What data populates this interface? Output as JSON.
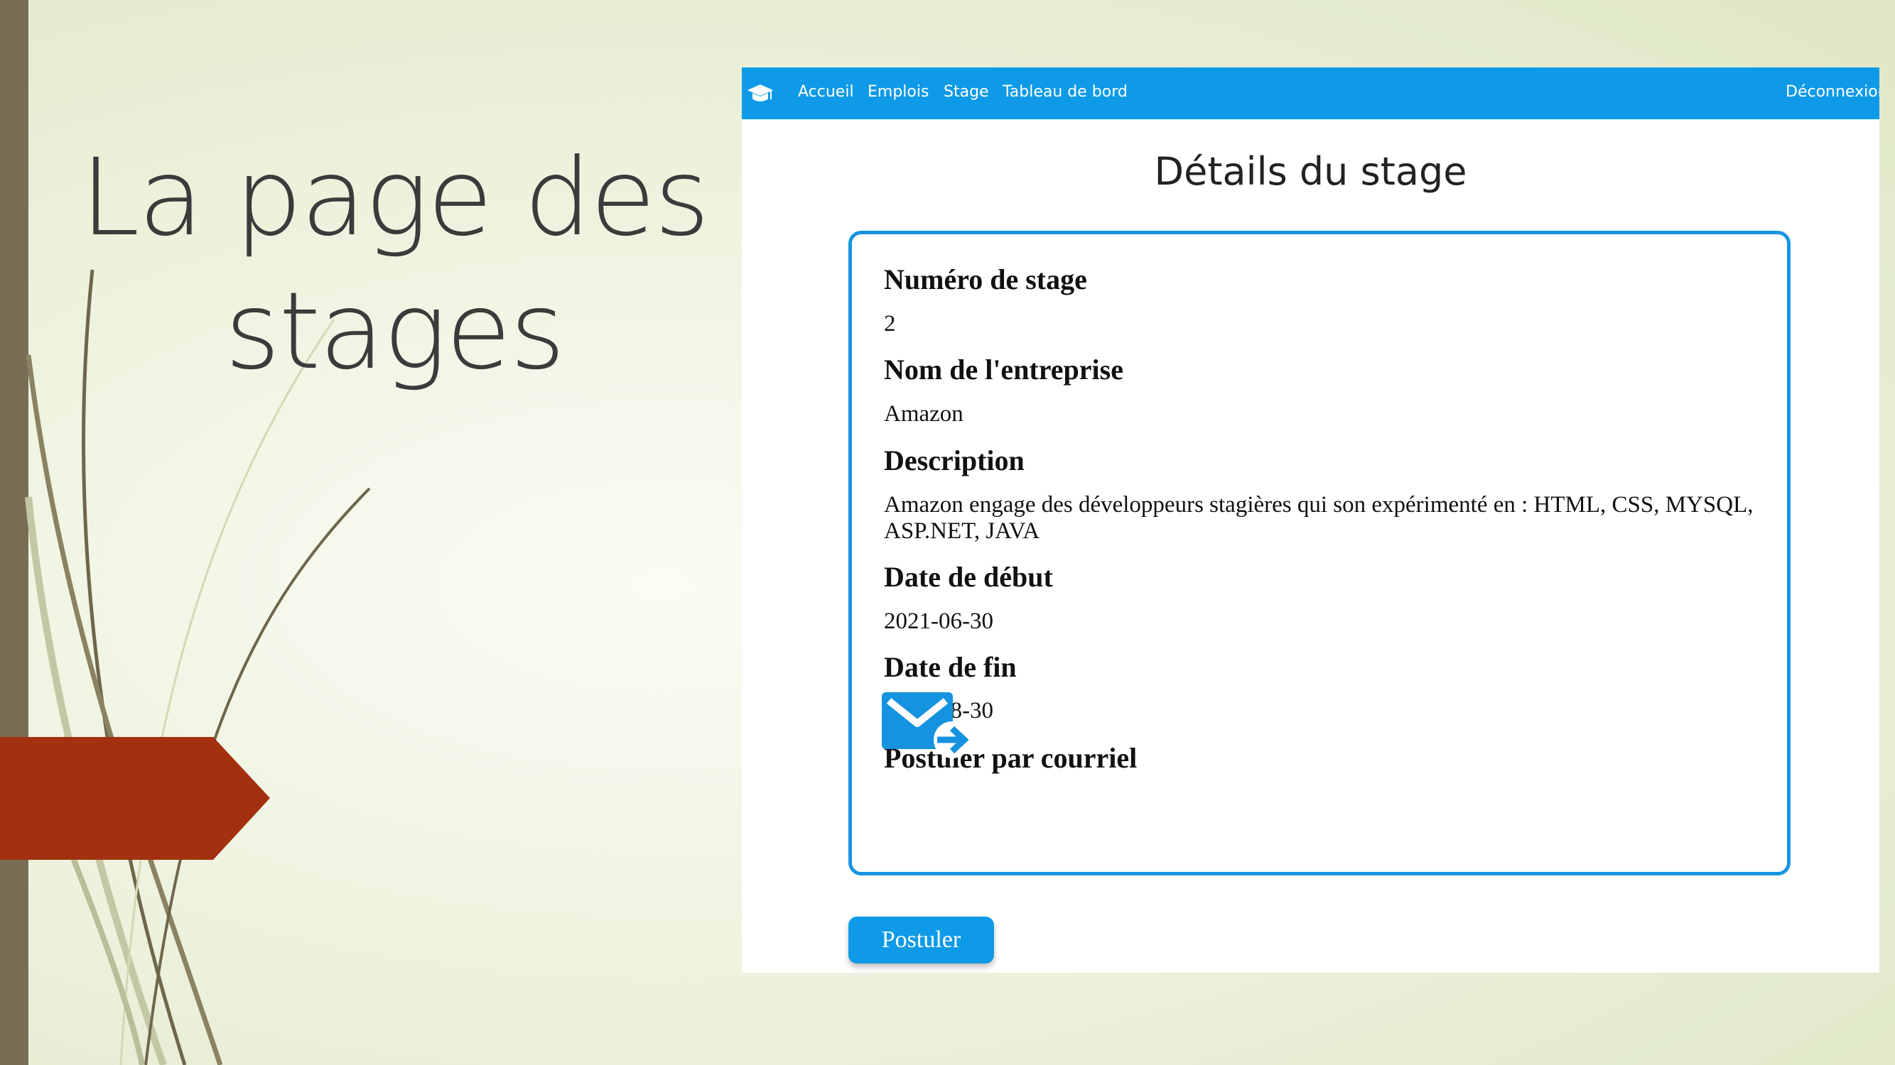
{
  "slide": {
    "title_line1": "La page des",
    "title_line2": "stages"
  },
  "navbar": {
    "logo_icon": "graduation-cap-icon",
    "links": [
      "Accueil",
      "Emplois",
      "Stage",
      "Tableau de bord"
    ],
    "logout": "Déconnexion"
  },
  "page": {
    "heading": "Détails du stage"
  },
  "details": {
    "fields": [
      {
        "label": "Numéro de stage",
        "value": "2"
      },
      {
        "label": "Nom de l'entreprise",
        "value": "Amazon"
      },
      {
        "label": "Description",
        "value": "Amazon engage des développeurs stagières qui son expérimenté en : HTML, CSS, MYSQL, ASP.NET, JAVA"
      },
      {
        "label": "Date de début",
        "value": "2021-06-30"
      },
      {
        "label": "Date de fin",
        "value": "2022-08-30"
      }
    ],
    "email_label": "Postuler par courriel",
    "email_icon": "send-mail-icon"
  },
  "apply_button": "Postuler",
  "colors": {
    "accent": "#0e9ae6",
    "side_bar": "#776e55",
    "arrow": "#a3300f"
  }
}
